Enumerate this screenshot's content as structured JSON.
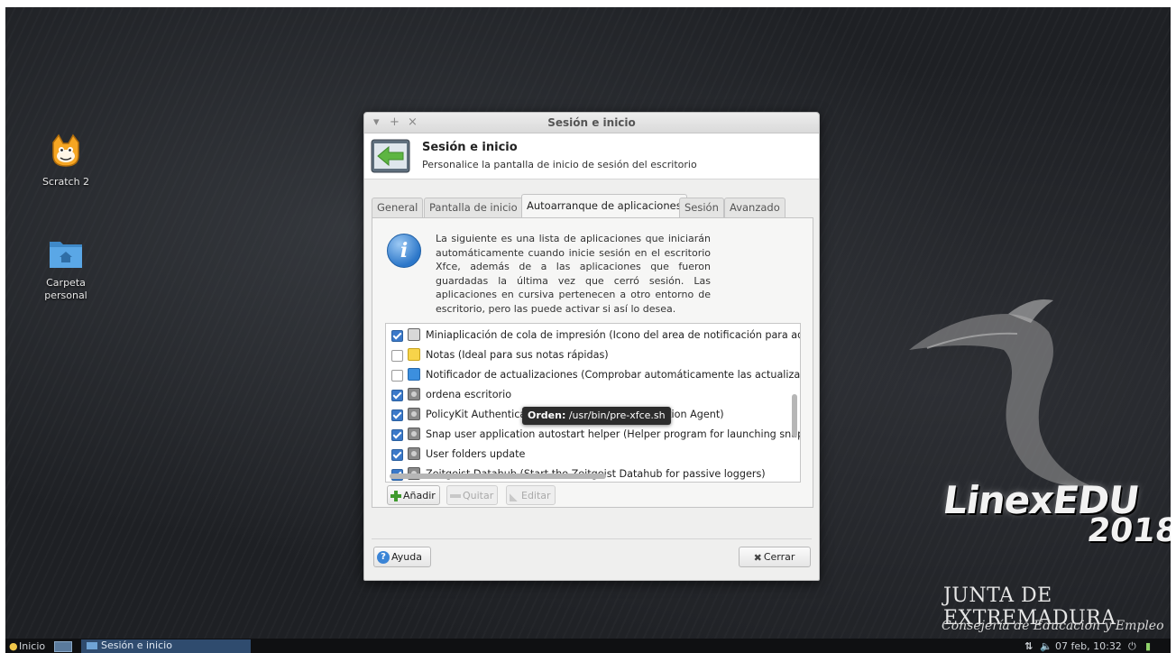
{
  "desktop": {
    "icons": [
      {
        "label": "Scratch 2"
      },
      {
        "label": "Carpeta\npersonal"
      }
    ],
    "branding": {
      "title": "LinexEDU",
      "year": "2018",
      "junta": "JUNTA DE EXTREMADURA",
      "consejeria": "Consejería de Educación y Empleo"
    }
  },
  "window": {
    "title": "Sesión e inicio",
    "header_title": "Sesión e inicio",
    "header_subtitle": "Personalice la pantalla de inicio de sesión del escritorio",
    "tabs": [
      {
        "label": "General",
        "active": false
      },
      {
        "label": "Pantalla de inicio",
        "active": false
      },
      {
        "label": "Autoarranque de aplicaciones",
        "active": true
      },
      {
        "label": "Sesión",
        "active": false
      },
      {
        "label": "Avanzado",
        "active": false
      }
    ],
    "info_text": "La siguiente es una lista de aplicaciones que iniciarán automáticamente cuando inicie sesión en el escritorio Xfce, además de a las aplicaciones que fueron guardadas la última vez que cerró sesión. Las aplicaciones en cursiva pertenecen a otro entorno de escritorio, pero las puede activar si así lo desea.",
    "apps": [
      {
        "checked": true,
        "icon": "printer-icon",
        "label": "Miniaplicación de cola de impresión (Icono del area de notificación para ad"
      },
      {
        "checked": false,
        "icon": "notes-icon",
        "label": "Notas (Ideal para sus notas rápidas)"
      },
      {
        "checked": false,
        "icon": "update-icon",
        "label": "Notificador de actualizaciones (Comprobar automáticamente las actualizac"
      },
      {
        "checked": true,
        "icon": "gear-icon",
        "label": "ordena escritorio"
      },
      {
        "checked": true,
        "icon": "gear-icon",
        "label": "PolicyKit Authenticati                                          tion Agent)"
      },
      {
        "checked": true,
        "icon": "gear-icon",
        "label": "Snap user application autostart helper (Helper program for launching snap"
      },
      {
        "checked": true,
        "icon": "gear-icon",
        "label": "User folders update"
      },
      {
        "checked": true,
        "icon": "gear-icon",
        "label": "Zeitgeist Datahub (Start the Zeitgeist Datahub for passive loggers)"
      }
    ],
    "tooltip": {
      "prefix": "Orden:",
      "value": "/usr/bin/pre-xfce.sh"
    },
    "buttons": {
      "add": "Añadir",
      "remove": "Quitar",
      "edit": "Editar",
      "help": "Ayuda",
      "close": "Cerrar"
    }
  },
  "taskbar": {
    "start_label": "Inicio",
    "task_label": "Sesión e inicio",
    "clock": "07 feb, 10:32"
  },
  "colors": {
    "accent": "#3b79c9",
    "desktop_bg": "#1e2024",
    "taskbar_bg": "#0f1012"
  }
}
